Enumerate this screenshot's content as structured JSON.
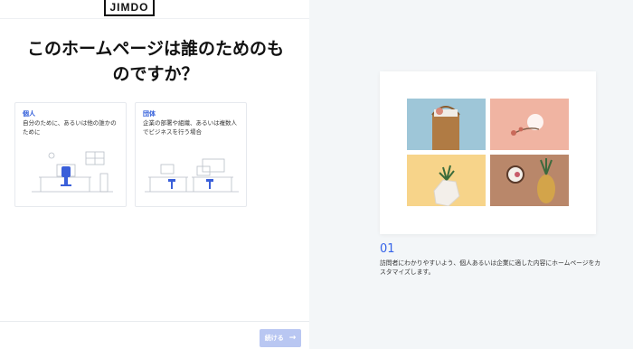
{
  "logo": "JIMDO",
  "title": "このホームページは誰のためのものですか？",
  "options": [
    {
      "title": "個人",
      "description": "自分のために、あるいは他の誰かのために",
      "illustration": "individual-desk-icon"
    },
    {
      "title": "団体",
      "description": "企業の部署や組織、あるいは複数人でビジネスを行う場合",
      "illustration": "team-desk-icon"
    }
  ],
  "next_button": {
    "label": "続ける",
    "icon": "arrow-right-icon"
  },
  "preview": {
    "step_number": "01",
    "step_description": "訪問者にわかりやすいよう、個人あるいは企業に適した内容にホームページをカスタマイズします。",
    "images": [
      "basket-photo",
      "flowers-photo",
      "succulent-photo",
      "coconut-pineapple-photo"
    ]
  },
  "colors": {
    "accent": "#3563e9",
    "button_disabled": "#b9c7f2",
    "panel_bg": "#f3f6f8"
  }
}
